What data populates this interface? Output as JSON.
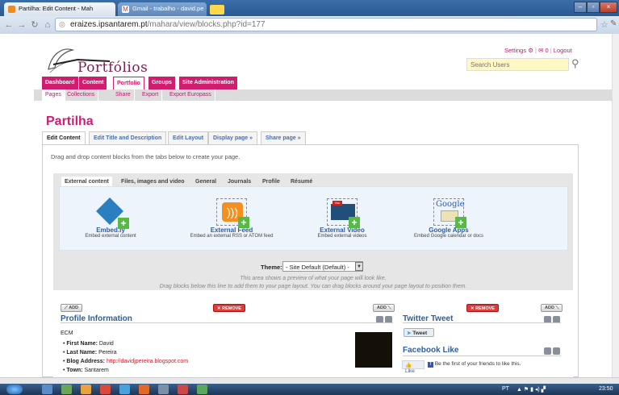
{
  "browser": {
    "tabs": [
      {
        "label": "Partilha: Edit Content - Mah"
      },
      {
        "label": "Gmail - trabalho - david.pe"
      }
    ],
    "url_host": "eraizes.ipsantarem.pt",
    "url_path": "/mahara/view/blocks.php?id=177"
  },
  "site": {
    "logo_text": "Portfólios",
    "settings": "Settings",
    "inbox_count": "0",
    "logout": "Logout",
    "search_placeholder": "Search Users"
  },
  "main_nav": [
    "Dashboard",
    "Content",
    "Portfolio",
    "Groups",
    "Site Administration"
  ],
  "sub_nav": [
    "Pages",
    "Collections",
    "Share",
    "Export",
    "Export Europass"
  ],
  "page_title": "Partilha",
  "edit_tabs": [
    "Edit Content",
    "Edit Title and Description",
    "Edit Layout",
    "Display page »",
    "Share page »"
  ],
  "instructions": "Drag and drop content blocks from the tabs below to create your page.",
  "category_tabs": [
    "External content",
    "Files, images and video",
    "General",
    "Journals",
    "Profile",
    "Résumé"
  ],
  "block_types": [
    {
      "name": "Embed.ly",
      "desc": "Embed external content",
      "icon": "embedly-icon"
    },
    {
      "name": "External Feed",
      "desc": "Embed an external RSS or ATOM feed",
      "icon": "rss-feed-icon"
    },
    {
      "name": "External Video",
      "desc": "Embed external videos",
      "icon": "video-icon"
    },
    {
      "name": "Google Apps",
      "desc": "Embed Google calendar or docs",
      "icon": "google-apps-icon"
    }
  ],
  "theme": {
    "label": "Theme:",
    "value": "- Site Default (Default) -"
  },
  "preview_note_1": "This area shows a preview of what your page will look like.",
  "preview_note_2": "Drag blocks below this line to add them to your page layout. You can drag blocks around your page layout to position them.",
  "buttons": {
    "add": "ADD",
    "remove": "REMOVE"
  },
  "profile_block": {
    "title": "Profile Information",
    "org": "ECM",
    "fields": [
      {
        "label": "First Name:",
        "value": "David"
      },
      {
        "label": "Last Name:",
        "value": "Pereira"
      },
      {
        "label": "Blog Address:",
        "value": "http://davidjpereira.blogspot.com"
      },
      {
        "label": "Town:",
        "value": "Santarem"
      }
    ]
  },
  "twitter_block": {
    "title": "Twitter Tweet",
    "tweet_label": "Tweet"
  },
  "facebook_block": {
    "title": "Facebook Like",
    "like_label": "Like",
    "text": "Be the first of your friends to like this."
  },
  "taskbar": {
    "lang": "PT",
    "time": "23:50"
  },
  "colors": {
    "brand": "#cf1d6f",
    "link": "#2f5d9a",
    "remove": "#e03a3a"
  }
}
